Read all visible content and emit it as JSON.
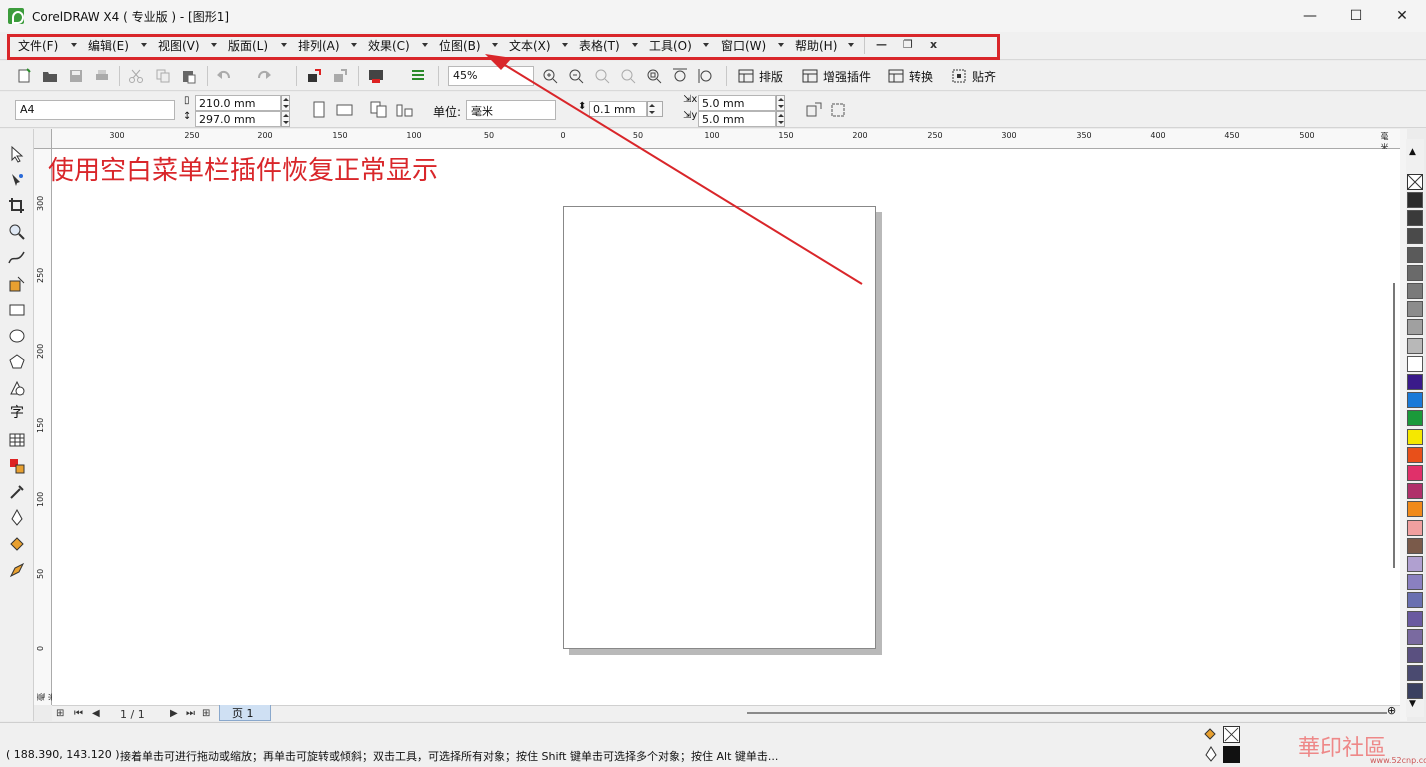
{
  "window": {
    "title": "CorelDRAW X4 ( 专业版 ) - [图形1]",
    "minimize": "—",
    "maximize": "☐",
    "close": "✕"
  },
  "menu": {
    "items": [
      "文件(F)",
      "编辑(E)",
      "视图(V)",
      "版面(L)",
      "排列(A)",
      "效果(C)",
      "位图(B)",
      "文本(X)",
      "表格(T)",
      "工具(O)",
      "窗口(W)",
      "帮助(H)"
    ],
    "mdi_minimize": "—",
    "mdi_restore": "❐",
    "mdi_close": "x"
  },
  "toolbar": {
    "zoom_value": "45%",
    "plugin_buttons": [
      "排版",
      "增强插件",
      "转换",
      "贴齐"
    ]
  },
  "propbar": {
    "paper_size": "A4",
    "width": "210.0 mm",
    "height": "297.0 mm",
    "unit_label": "单位:",
    "unit_value": "毫米",
    "nudge": "0.1 mm",
    "dup_x": "5.0 mm",
    "dup_y": "5.0 mm"
  },
  "rulers": {
    "h_labels": [
      "300",
      "250",
      "200",
      "150",
      "100",
      "50",
      "0",
      "50",
      "100",
      "150",
      "200",
      "250",
      "300",
      "350",
      "400",
      "450",
      "500",
      "毫米"
    ],
    "v_labels": [
      "300",
      "250",
      "200",
      "150",
      "100",
      "50",
      "0",
      "毫米"
    ]
  },
  "annotation": {
    "text": "使用空白菜单栏插件恢复正常显示",
    "color": "#d9262a"
  },
  "pagenav": {
    "page_count": "1 / 1",
    "page_tab": "页 1"
  },
  "palette": {
    "colors": [
      "#2a2a2a",
      "#3a3a3a",
      "#4a4a4a",
      "#5a5a5a",
      "#6a6a6a",
      "#7a7a7a",
      "#8c8c8c",
      "#a0a0a0",
      "#b8b8b8",
      "#ffffff",
      "#3a1a8a",
      "#1a7ad8",
      "#1a9a3a",
      "#f5e800",
      "#e8501a",
      "#e0306a",
      "#b0306a",
      "#f08a1a",
      "#f0a0a0",
      "#7a5a4a",
      "#b0a0d0",
      "#8a80c0",
      "#6a70b0",
      "#6a5aa0",
      "#7a6aa0",
      "#5a5080",
      "#4a4a70",
      "#3a4060"
    ]
  },
  "status": {
    "coords": "( 188.390, 143.120 )",
    "hint": "接着单击可进行拖动或缩放；再单击可旋转或倾斜；双击工具，可选择所有对象；按住 Shift 键单击可选择多个对象；按住 Alt 键单击..."
  },
  "watermark": {
    "text": "華印社區",
    "url": "www.52cnp.com"
  }
}
